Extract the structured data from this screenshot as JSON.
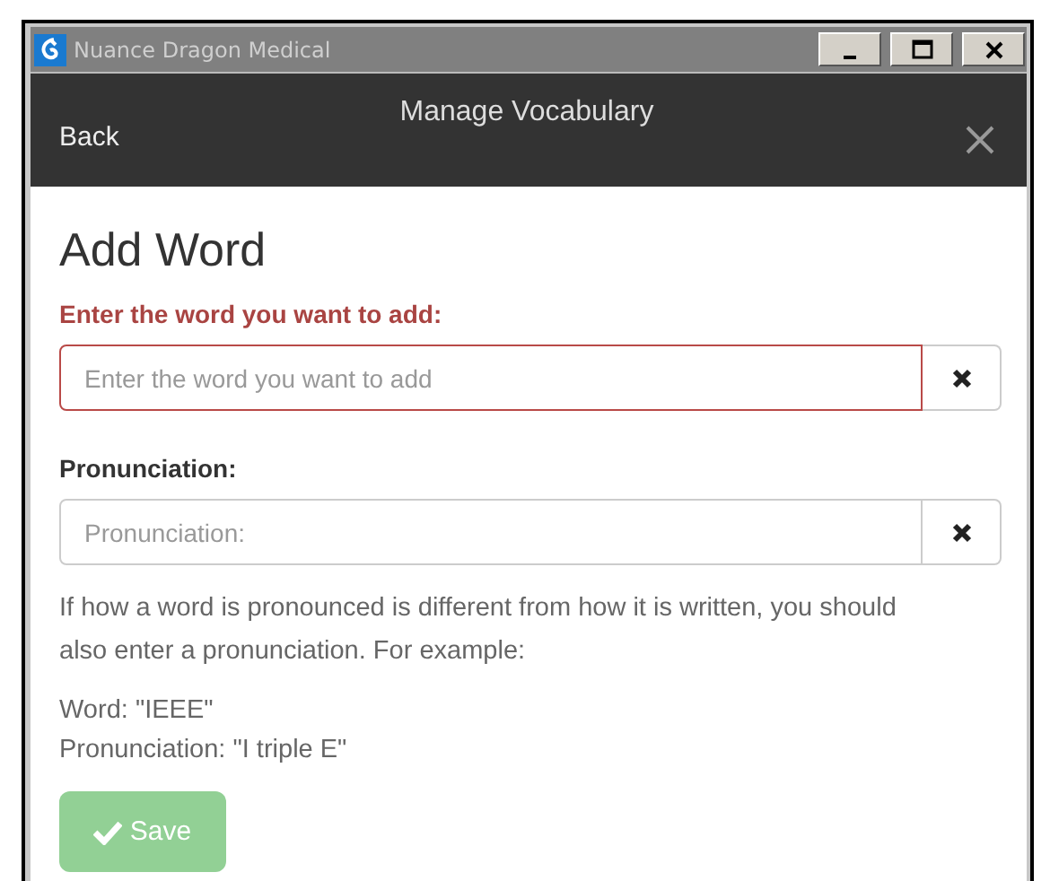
{
  "window": {
    "title": "Nuance Dragon Medical"
  },
  "header": {
    "back": "Back",
    "title": "Manage Vocabulary"
  },
  "form": {
    "heading": "Add Word",
    "fields": [
      {
        "label": "Enter the word you want to add:",
        "placeholder": "Enter the word you want to add",
        "invalid": true
      },
      {
        "label": "Pronunciation:",
        "placeholder": "Pronunciation:",
        "invalid": false
      }
    ],
    "help": "If how a word is pronounced is different from how it is written, you should also enter a pronunciation. For example:",
    "example": [
      "Word: \"IEEE\"",
      "Pronunciation: \"I triple E\""
    ],
    "save": {
      "label": "Save",
      "disabled": true
    }
  }
}
